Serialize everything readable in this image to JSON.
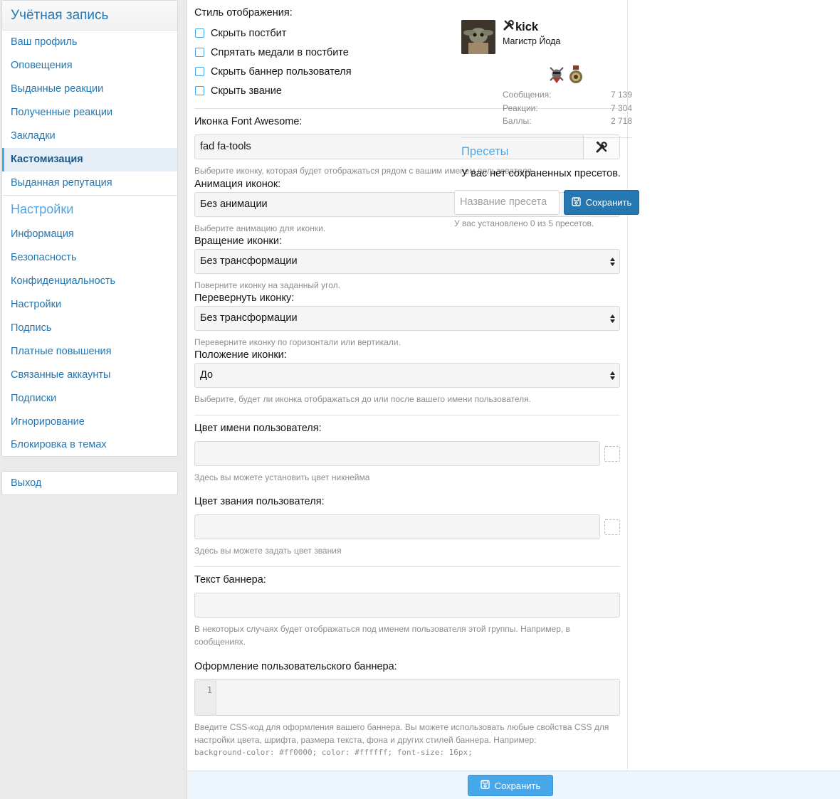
{
  "sidebar": {
    "account_title": "Учётная запись",
    "account_items": [
      {
        "label": "Ваш профиль"
      },
      {
        "label": "Оповещения"
      },
      {
        "label": "Выданные реакции"
      },
      {
        "label": "Полученные реакции"
      },
      {
        "label": "Закладки"
      },
      {
        "label": "Кастомизация"
      },
      {
        "label": "Выданная репутация"
      }
    ],
    "settings_title": "Настройки",
    "settings_items": [
      {
        "label": "Информация"
      },
      {
        "label": "Безопасность"
      },
      {
        "label": "Конфиденциальность"
      },
      {
        "label": "Настройки"
      },
      {
        "label": "Подпись"
      },
      {
        "label": "Платные повышения"
      },
      {
        "label": "Связанные аккаунты"
      },
      {
        "label": "Подписки"
      },
      {
        "label": "Игнорирование"
      },
      {
        "label": "Блокировка в темах"
      }
    ],
    "logout": "Выход"
  },
  "form": {
    "display_style_label": "Стиль отображения:",
    "checkboxes": [
      {
        "label": "Скрыть постбит",
        "checked": false
      },
      {
        "label": "Спрятать медали в постбите",
        "checked": false
      },
      {
        "label": "Скрыть баннер пользователя",
        "checked": false
      },
      {
        "label": "Скрыть звание",
        "checked": false
      }
    ],
    "icon_label": "Иконка Font Awesome:",
    "icon_value": "fad fa-tools",
    "icon_hint": "Выберите иконку, которая будет отображаться рядом с вашим именем пользователя.",
    "animation_label": "Анимация иконок:",
    "animation_value": "Без анимации",
    "animation_hint": "Выберите анимацию для иконки.",
    "rotation_label": "Вращение иконки:",
    "rotation_value": "Без трансформации",
    "rotation_hint": "Поверните иконку на заданный угол.",
    "flip_label": "Перевернуть иконку:",
    "flip_value": "Без трансформации",
    "flip_hint": "Переверните иконку по горизонтали или вертикали.",
    "position_label": "Положение иконки:",
    "position_value": "До",
    "position_hint": "Выберите, будет ли иконка отображаться до или после вашего имени пользователя.",
    "name_color_label": "Цвет имени пользователя:",
    "name_color_hint": "Здесь вы можете установить цвет никнейма",
    "title_color_label": "Цвет звания пользователя:",
    "title_color_hint": "Здесь вы можете задать цвет звания",
    "banner_text_label": "Текст баннера:",
    "banner_text_hint": "В некоторых случаях будет отображаться под именем пользователя этой группы. Например, в сообщениях.",
    "banner_style_label": "Оформление пользовательского баннера:",
    "code_line": "1",
    "banner_style_hint": "Введите CSS-код для оформления вашего баннера. Вы можете использовать любые свойства CSS для настройки цвета, шрифта, размера текста, фона и других стилей баннера. Например:",
    "banner_style_example": "background-color: #ff0000; color: #ffffff; font-size: 16px;",
    "save_label": "Сохранить"
  },
  "preview": {
    "username": "kick",
    "user_title": "Магистр Йода",
    "stats": [
      {
        "label": "Сообщения:",
        "value": "7 139"
      },
      {
        "label": "Реакции:",
        "value": "7 304"
      },
      {
        "label": "Баллы:",
        "value": "2 718"
      }
    ],
    "presets_title": "Пресеты",
    "presets_empty": "У вас нет сохраненных пресетов.",
    "preset_placeholder": "Название пресета",
    "preset_save": "Сохранить",
    "preset_hint": "У вас установлено 0 из 5 пресетов."
  },
  "colors": {
    "accent": "#47a7eb",
    "link": "#2577b1",
    "dark_button": "#2577b1"
  }
}
